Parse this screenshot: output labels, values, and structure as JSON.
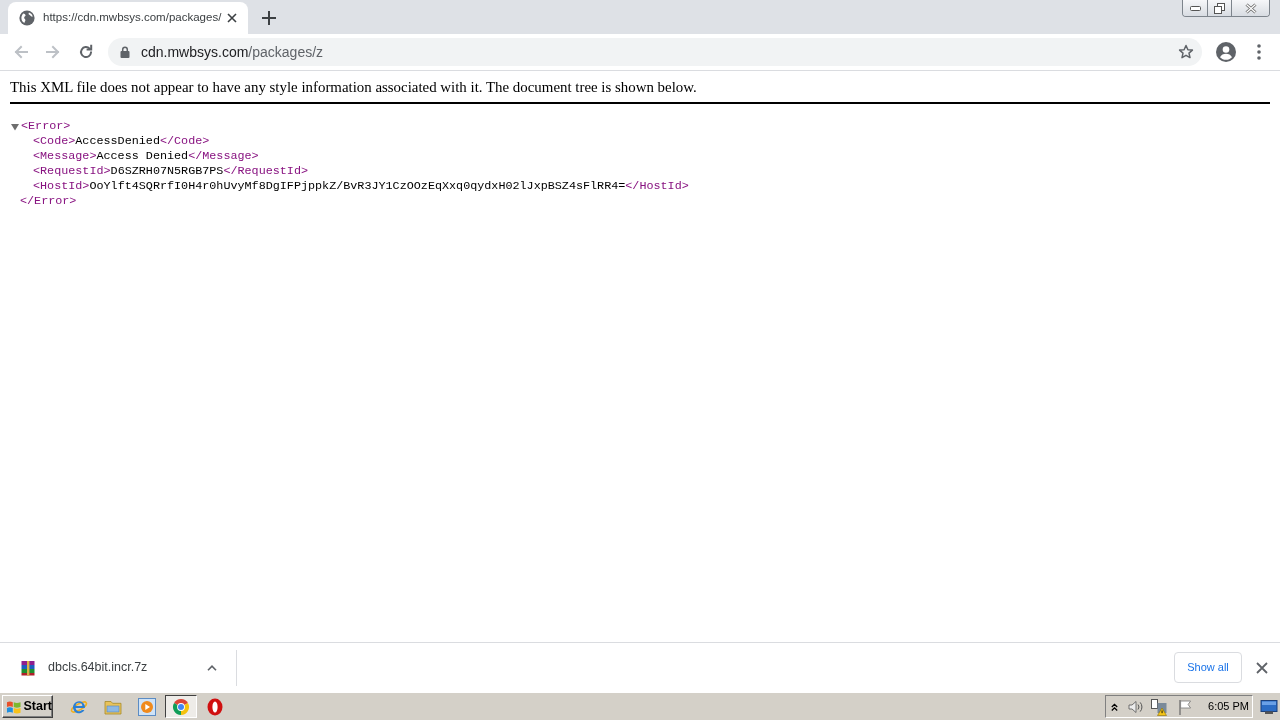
{
  "tabs": [
    {
      "title": "https://cdn.mwbsys.com/packages/",
      "selected": true
    }
  ],
  "nav_buttons": [
    {
      "kind": "back",
      "disabled": true
    },
    {
      "kind": "forward",
      "disabled": true
    },
    {
      "kind": "reload",
      "disabled": false
    }
  ],
  "address_bar": {
    "host": "cdn.mwbsys.com",
    "path": "/packages/z"
  },
  "page": {
    "notice": "This XML file does not appear to have any style information associated with it. The document tree is shown below.",
    "xml_tree": {
      "open": "<Error>",
      "close": "</Error>",
      "expanded": true,
      "children": [
        {
          "open": "<Code>",
          "text": "AccessDenied",
          "close": "</Code>"
        },
        {
          "open": "<Message>",
          "text": "Access Denied",
          "close": "</Message>"
        },
        {
          "open": "<RequestId>",
          "text": "D6SZRH07N5RGB7PS",
          "close": "</RequestId>"
        },
        {
          "open": "<HostId>",
          "text": "OoYlft4SQRrfI0H4r0hUvyMf8DgIFPjppkZ/BvR3JY1CzOOzEqXxq0qydxH02lJxpBSZ4sFlRR4=",
          "close": "</HostId>"
        }
      ]
    }
  },
  "downloads": [
    {
      "filename": "dbcls.64bit.incr.7z"
    }
  ],
  "download_bar": {
    "show_all": "Show all"
  },
  "taskbar": {
    "start": "Start",
    "apps": [
      {
        "kind": "ie",
        "selected": false
      },
      {
        "kind": "folder",
        "selected": false
      },
      {
        "kind": "media",
        "selected": false
      },
      {
        "kind": "chrome",
        "selected": true
      },
      {
        "kind": "opera",
        "selected": false
      }
    ],
    "clock": "6:05 PM"
  }
}
